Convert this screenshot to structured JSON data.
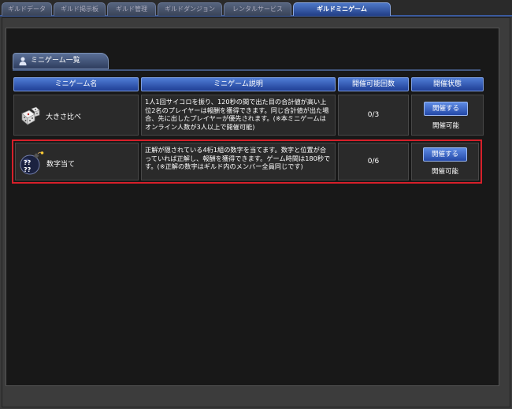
{
  "tabs": [
    {
      "label": "ギルドデータ",
      "active": false
    },
    {
      "label": "ギルド掲示板",
      "active": false
    },
    {
      "label": "ギルド管理",
      "active": false
    },
    {
      "label": "ギルドダンジョン",
      "active": false
    },
    {
      "label": "レンタルサービス",
      "active": false
    },
    {
      "label": "ギルドミニゲーム",
      "active": true
    }
  ],
  "section": {
    "title": "ミニゲーム一覧",
    "icon": "person-icon"
  },
  "table": {
    "headers": [
      "ミニゲーム名",
      "ミニゲーム説明",
      "開催可能回数",
      "開催状態"
    ],
    "rows": [
      {
        "icon": "dice-icon",
        "name": "大きさ比べ",
        "description": "1人1回サイコロを振り、120秒の間で出た目の合計値が高い上位2名のプレイヤーは報酬を獲得できます。同じ合計値が出た場合、先に出したプレイヤーが優先されます。(※本ミニゲームはオンライン人数が3人以上で開催可能)",
        "count": "0/3",
        "button": "開催する",
        "status": "開催可能"
      },
      {
        "icon": "bomb-icon",
        "name": "数字当て",
        "description": "正解が隠されている4桁1組の数字を当てます。数字と位置が合っていれば正解し、報酬を獲得できます。ゲーム時間は180秒です。(※正解の数字はギルド内のメンバー全員同じです)",
        "count": "0/6",
        "button": "開催する",
        "status": "開催可能"
      }
    ]
  },
  "colors": {
    "highlight": "#d6202a",
    "accent": "#3a63c4"
  }
}
